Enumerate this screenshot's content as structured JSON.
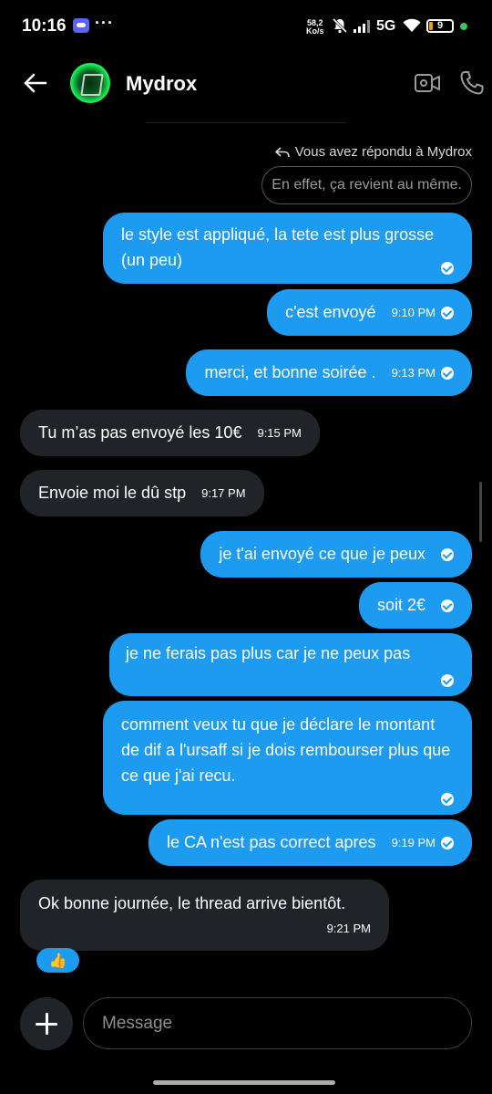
{
  "status_bar": {
    "time": "10:16",
    "dots": "···",
    "net_speed_value": "58,2",
    "net_speed_unit": "Ko/s",
    "network": "5G",
    "battery": "9",
    "icons": [
      "discord-icon",
      "mute-icon",
      "signal-icon",
      "wifi-icon",
      "battery-icon"
    ]
  },
  "header": {
    "contact_name": "Mydrox",
    "icons": [
      "back-arrow-icon",
      "video-call-icon",
      "phone-icon"
    ]
  },
  "reply_context": {
    "label": "Vous avez répondu à Mydrox",
    "quoted": "En effet, ça revient au même."
  },
  "messages": [
    {
      "dir": "out",
      "text": "le style est appliqué, la tete est plus grosse (un peu)",
      "time": ""
    },
    {
      "dir": "out",
      "text": "c'est envoyé",
      "time": "9:10 PM"
    },
    {
      "dir": "out",
      "text": "merci, et bonne soirée .",
      "time": "9:13 PM"
    },
    {
      "dir": "in",
      "text": "Tu m’as pas envoyé les 10€",
      "time": "9:15 PM"
    },
    {
      "dir": "in",
      "text": "Envoie moi le dû stp",
      "time": "9:17 PM"
    },
    {
      "dir": "out",
      "text": "je t'ai envoyé ce que je peux",
      "time": ""
    },
    {
      "dir": "out",
      "text": "soit 2€",
      "time": ""
    },
    {
      "dir": "out",
      "text": "je ne ferais pas plus car je ne peux pas",
      "time": ""
    },
    {
      "dir": "out",
      "text": "comment veux tu que je déclare le montant de dif a l'ursaff si je dois rembourser plus que ce que j'ai recu.",
      "time": ""
    },
    {
      "dir": "out",
      "text": "le CA n'est pas correct apres",
      "time": "9:19 PM"
    },
    {
      "dir": "in",
      "text": "Ok bonne journée, le thread arrive bientôt.",
      "time": "9:21 PM"
    }
  ],
  "reaction": "👍",
  "composer": {
    "placeholder": "Message"
  },
  "colors": {
    "background": "#000000",
    "outgoing_bubble": "#1d9bf0",
    "incoming_bubble": "#202327"
  }
}
